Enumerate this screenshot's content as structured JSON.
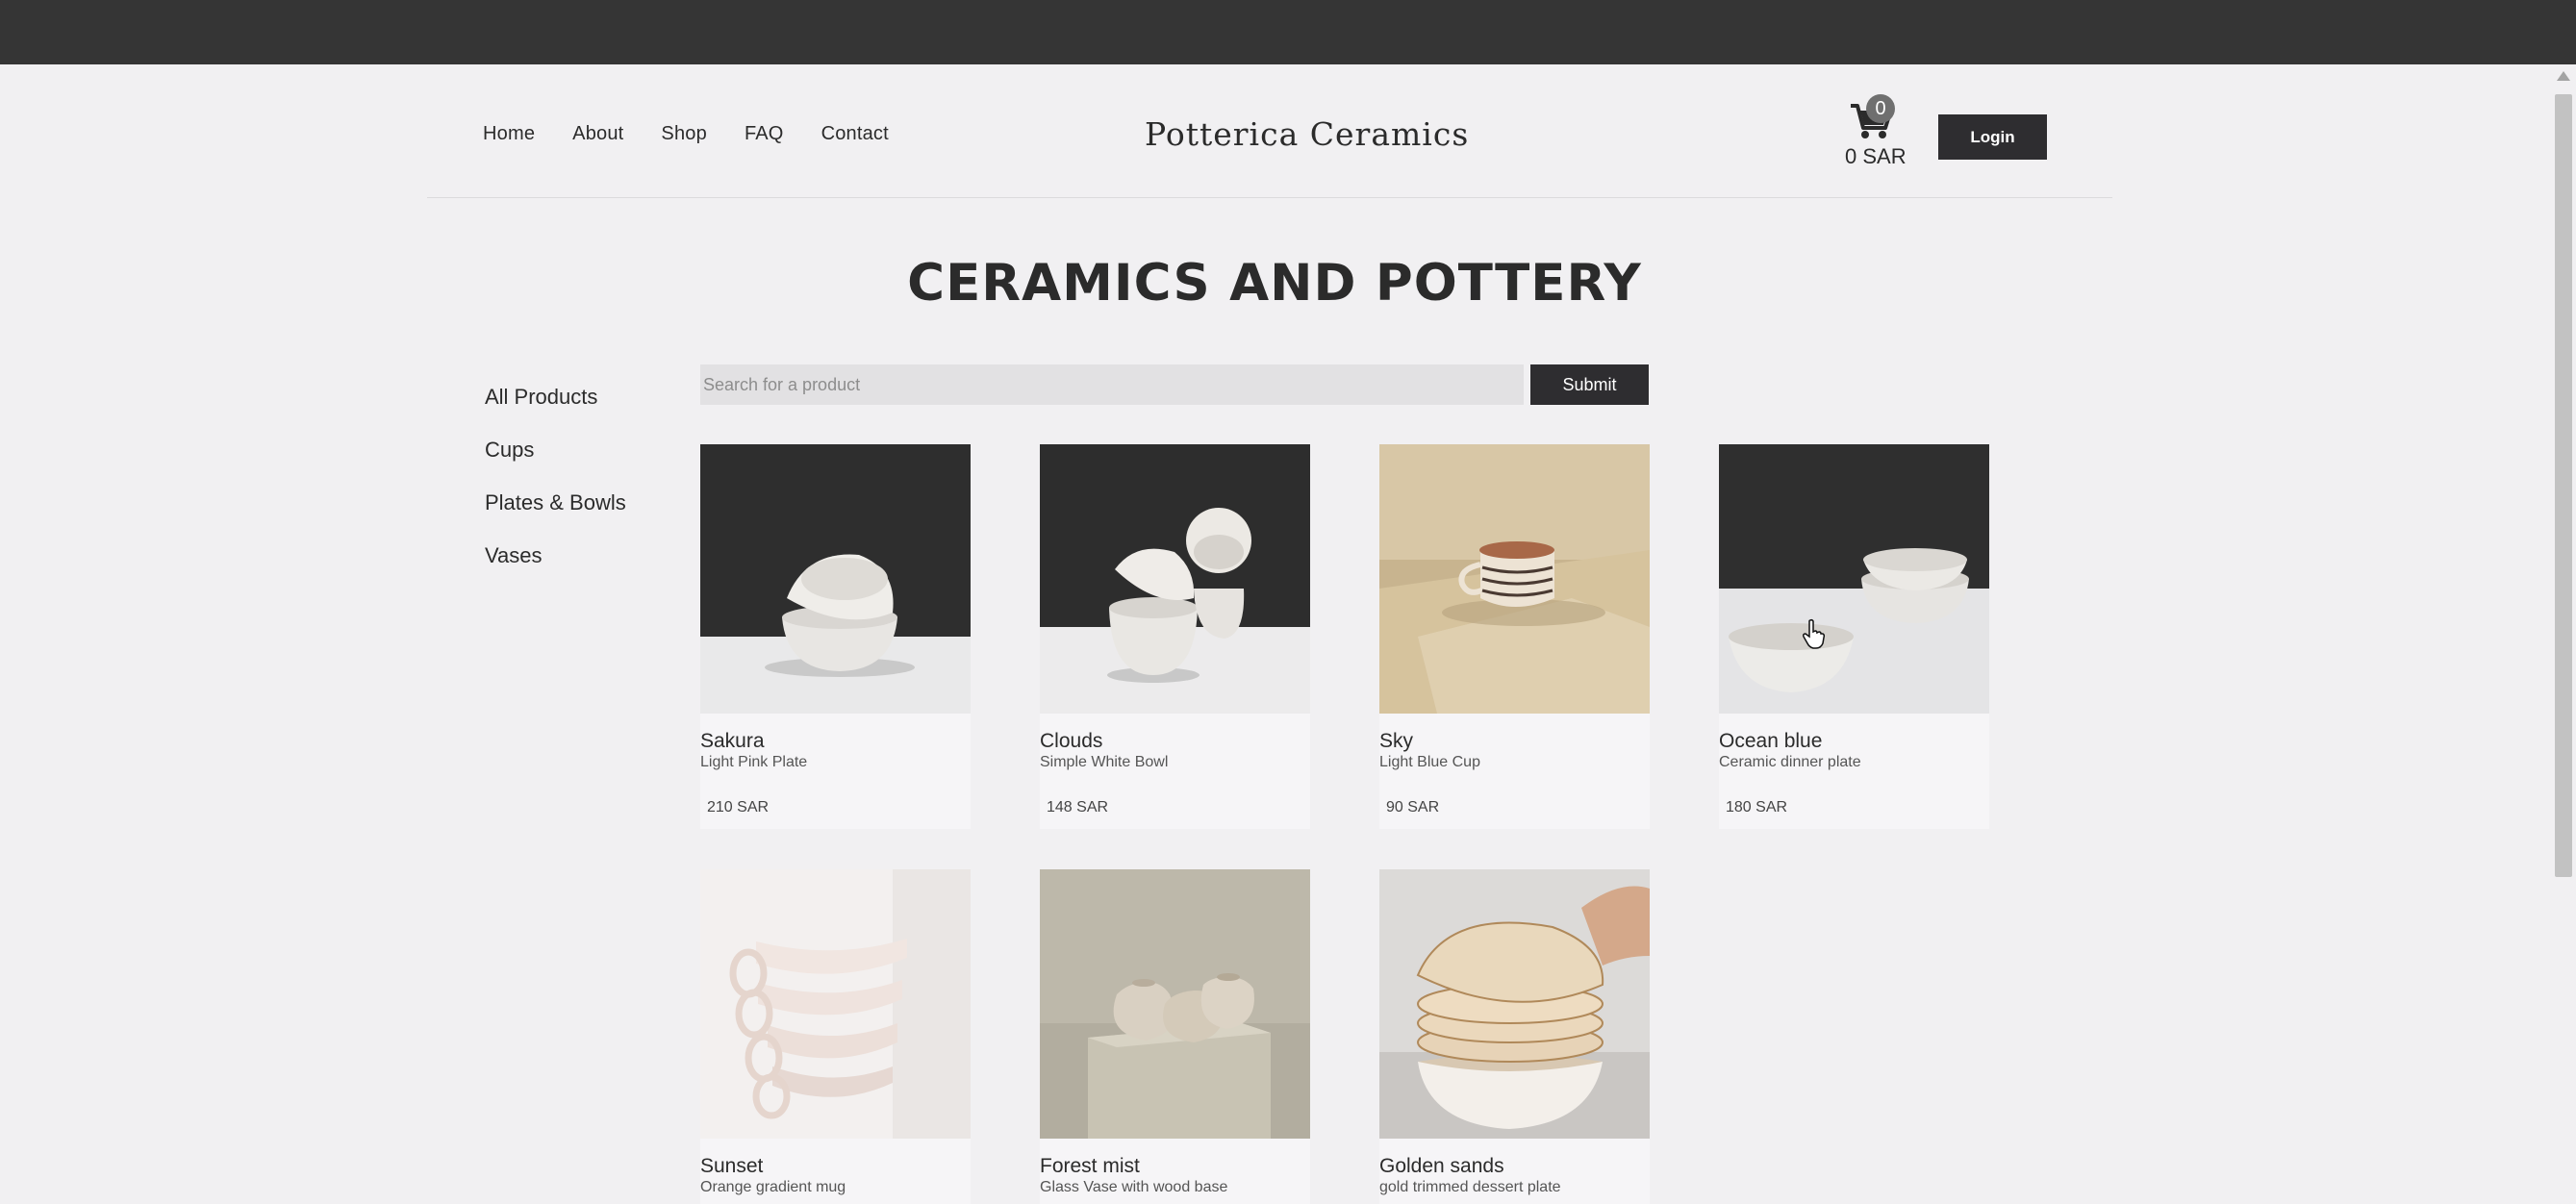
{
  "nav": {
    "items": [
      {
        "label": "Home"
      },
      {
        "label": "About"
      },
      {
        "label": "Shop"
      },
      {
        "label": "FAQ"
      },
      {
        "label": "Contact"
      }
    ]
  },
  "brand": {
    "name": "Potterica Ceramics"
  },
  "cart": {
    "count": "0",
    "total": "0 SAR"
  },
  "header": {
    "login_label": "Login"
  },
  "page": {
    "title": "CERAMICS AND POTTERY"
  },
  "sidebar": {
    "items": [
      {
        "label": "All Products"
      },
      {
        "label": "Cups"
      },
      {
        "label": "Plates & Bowls"
      },
      {
        "label": "Vases"
      }
    ]
  },
  "search": {
    "placeholder": "Search for a product",
    "value": "",
    "submit_label": "Submit"
  },
  "products": [
    {
      "name": "Sakura",
      "description": "Light Pink Plate",
      "price": "210 SAR"
    },
    {
      "name": "Clouds",
      "description": "Simple White Bowl",
      "price": "148 SAR"
    },
    {
      "name": "Sky",
      "description": "Light Blue Cup",
      "price": "90 SAR"
    },
    {
      "name": "Ocean blue",
      "description": "Ceramic dinner plate",
      "price": "180 SAR"
    },
    {
      "name": "Sunset",
      "description": "Orange gradient mug",
      "price": ""
    },
    {
      "name": "Forest mist",
      "description": "Glass Vase with wood base",
      "price": ""
    },
    {
      "name": "Golden sands",
      "description": "gold trimmed dessert plate",
      "price": ""
    }
  ],
  "colors": {
    "accent": "#2e2d30",
    "background": "#f1f0f2",
    "topbar": "#353535"
  },
  "icons": {
    "cart": "cart-icon",
    "cursor": "pointer-cursor-icon"
  }
}
